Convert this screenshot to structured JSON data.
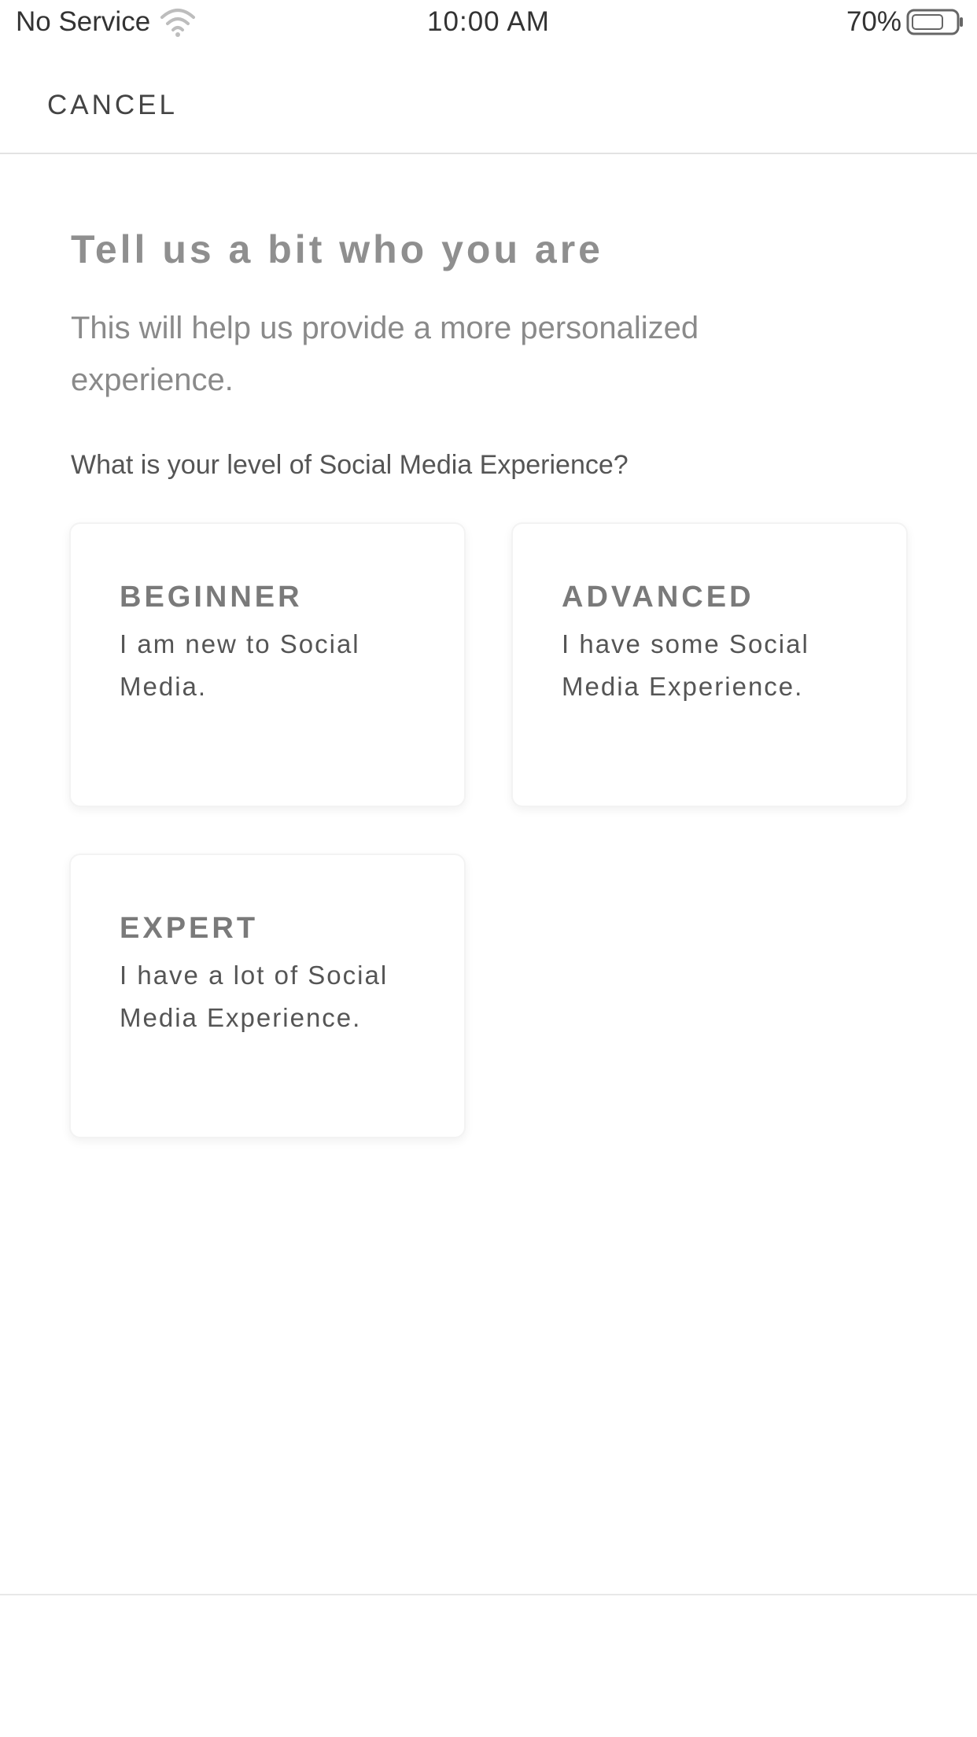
{
  "status_bar": {
    "carrier": "No Service",
    "time": "10:00 AM",
    "battery": "70%"
  },
  "nav": {
    "cancel_label": "CANCEL"
  },
  "header": {
    "title": "Tell us a bit who you are",
    "subtitle": "This will help us provide a more personalized experience."
  },
  "question": "What is your level of Social Media Experience?",
  "levels": [
    {
      "title": "BEGINNER",
      "description": "I am new to Social Media."
    },
    {
      "title": "ADVANCED",
      "description": "I have some Social Media Experience."
    },
    {
      "title": "EXPERT",
      "description": "I have a lot of Social Media Experience."
    }
  ],
  "icons": {
    "wifi": "wifi-icon",
    "battery": "battery-icon"
  },
  "colors": {
    "background": "#ffffff",
    "title": "#8f8f8f",
    "text": "#555555",
    "divider": "#e3e3e3"
  }
}
